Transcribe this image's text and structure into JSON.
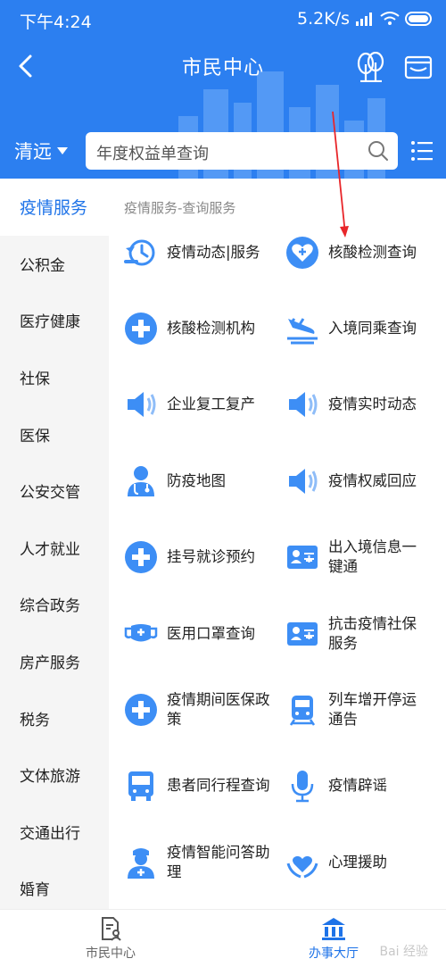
{
  "status_bar": {
    "time": "下午4:24",
    "network": "5.2K/s"
  },
  "header": {
    "title": "市民中心"
  },
  "location": {
    "city": "清远"
  },
  "search": {
    "placeholder": "年度权益单查询"
  },
  "sidebar": {
    "items": [
      {
        "label": "疫情服务",
        "active": true
      },
      {
        "label": "公积金"
      },
      {
        "label": "医疗健康"
      },
      {
        "label": "社保"
      },
      {
        "label": "医保"
      },
      {
        "label": "公安交管"
      },
      {
        "label": "人才就业"
      },
      {
        "label": "综合政务"
      },
      {
        "label": "房产服务"
      },
      {
        "label": "税务"
      },
      {
        "label": "文体旅游"
      },
      {
        "label": "交通出行"
      },
      {
        "label": "婚育"
      }
    ]
  },
  "content": {
    "section_title": "疫情服务-查询服务",
    "services": [
      {
        "label": "疫情动态|服务",
        "icon": "clock-refresh-icon"
      },
      {
        "label": "核酸检测查询",
        "icon": "heart-plus-icon"
      },
      {
        "label": "核酸检测机构",
        "icon": "medical-plus-icon"
      },
      {
        "label": "入境同乘查询",
        "icon": "airplane-landing-icon"
      },
      {
        "label": "企业复工复产",
        "icon": "speaker-icon"
      },
      {
        "label": "疫情实时动态",
        "icon": "speaker-icon"
      },
      {
        "label": "防疫地图",
        "icon": "doctor-icon"
      },
      {
        "label": "疫情权威回应",
        "icon": "speaker-icon"
      },
      {
        "label": "挂号就诊预约",
        "icon": "medical-plus-icon"
      },
      {
        "label": "出入境信息一键通",
        "icon": "id-card-icon"
      },
      {
        "label": "医用口罩查询",
        "icon": "mask-icon"
      },
      {
        "label": "抗击疫情社保服务",
        "icon": "id-card-icon"
      },
      {
        "label": "疫情期间医保政策",
        "icon": "medical-plus-icon"
      },
      {
        "label": "列车增开停运通告",
        "icon": "train-icon"
      },
      {
        "label": "患者同行程查询",
        "icon": "bus-icon"
      },
      {
        "label": "疫情辟谣",
        "icon": "microphone-icon"
      },
      {
        "label": "疫情智能问答助理",
        "icon": "nurse-icon"
      },
      {
        "label": "心理援助",
        "icon": "heart-hands-icon"
      }
    ]
  },
  "tabbar": {
    "items": [
      {
        "label": "市民中心",
        "icon": "citizen-doc-icon"
      },
      {
        "label": "办事大厅",
        "icon": "hall-building-icon",
        "active": true
      }
    ]
  },
  "watermark": "Bai 经验",
  "colors": {
    "brand": "#2c7ff0",
    "active": "#1e73e8",
    "icon_blue": "#3d8ef5",
    "annotation": "#e8262a"
  }
}
